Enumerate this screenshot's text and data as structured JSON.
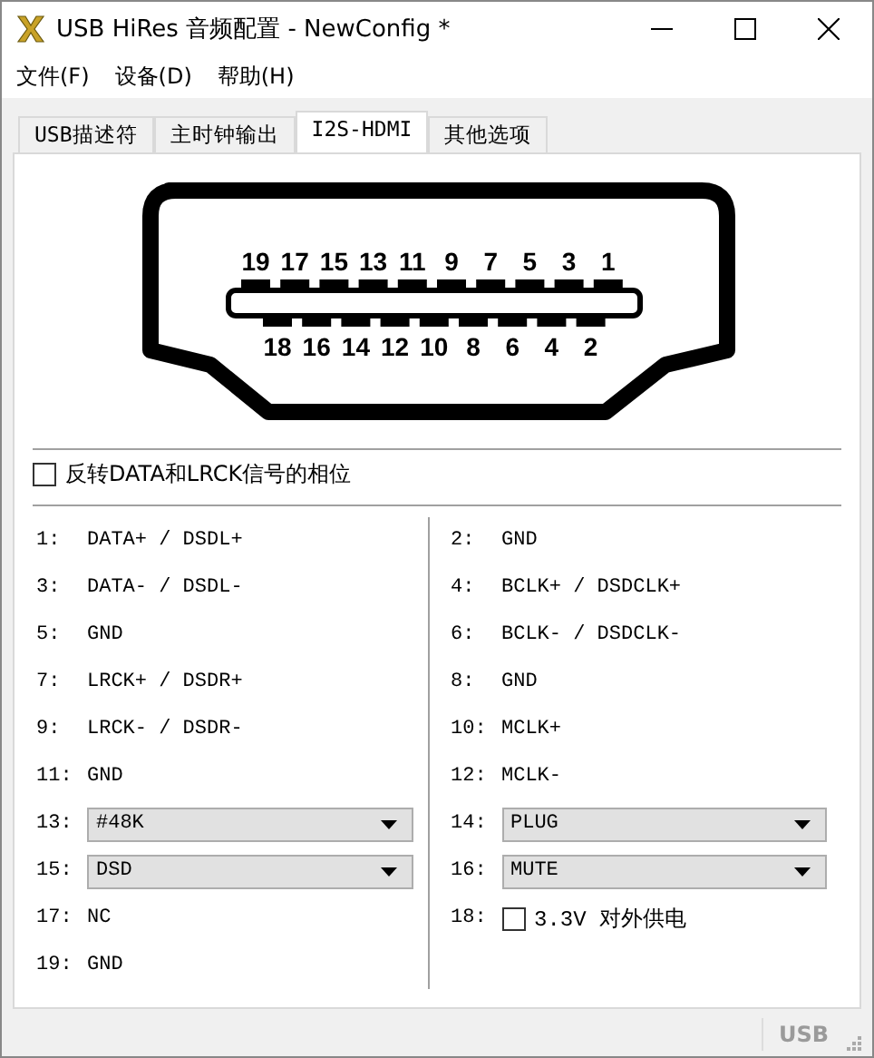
{
  "window": {
    "title": "USB HiRes 音频配置 - NewConfig *"
  },
  "menu": [
    "文件(F)",
    "设备(D)",
    "帮助(H)"
  ],
  "tabs": [
    {
      "label": "USB描述符",
      "selected": false
    },
    {
      "label": "主时钟输出",
      "selected": false
    },
    {
      "label": "I2S-HDMI",
      "selected": true
    },
    {
      "label": "其他选项",
      "selected": false
    }
  ],
  "connector": {
    "top_pins": [
      "19",
      "17",
      "15",
      "13",
      "11",
      "9",
      "7",
      "5",
      "3",
      "1"
    ],
    "bottom_pins": [
      "18",
      "16",
      "14",
      "12",
      "10",
      "8",
      "6",
      "4",
      "2"
    ]
  },
  "invert_option": {
    "label": "反转DATA和LRCK信号的相位",
    "checked": false
  },
  "left_pins": [
    {
      "number": "1:",
      "kind": "text",
      "value": "DATA+ / DSDL+"
    },
    {
      "number": "3:",
      "kind": "text",
      "value": "DATA- / DSDL-"
    },
    {
      "number": "5:",
      "kind": "text",
      "value": "GND"
    },
    {
      "number": "7:",
      "kind": "text",
      "value": "LRCK+ / DSDR+"
    },
    {
      "number": "9:",
      "kind": "text",
      "value": "LRCK- / DSDR-"
    },
    {
      "number": "11:",
      "kind": "text",
      "value": "GND"
    },
    {
      "number": "13:",
      "kind": "select",
      "value": "#48K"
    },
    {
      "number": "15:",
      "kind": "select",
      "value": "DSD"
    },
    {
      "number": "17:",
      "kind": "text",
      "value": "NC"
    },
    {
      "number": "19:",
      "kind": "text",
      "value": "GND"
    }
  ],
  "right_pins": [
    {
      "number": "2:",
      "kind": "text",
      "value": "GND"
    },
    {
      "number": "4:",
      "kind": "text",
      "value": "BCLK+ / DSDCLK+"
    },
    {
      "number": "6:",
      "kind": "text",
      "value": "BCLK- / DSDCLK-"
    },
    {
      "number": "8:",
      "kind": "text",
      "value": "GND"
    },
    {
      "number": "10:",
      "kind": "text",
      "value": "MCLK+"
    },
    {
      "number": "12:",
      "kind": "text",
      "value": "MCLK-"
    },
    {
      "number": "14:",
      "kind": "select",
      "value": "PLUG"
    },
    {
      "number": "16:",
      "kind": "select",
      "value": "MUTE"
    },
    {
      "number": "18:",
      "kind": "checkbox",
      "value": "3.3V 对外供电",
      "checked": false
    }
  ],
  "status_bar": {
    "text": "USB"
  }
}
